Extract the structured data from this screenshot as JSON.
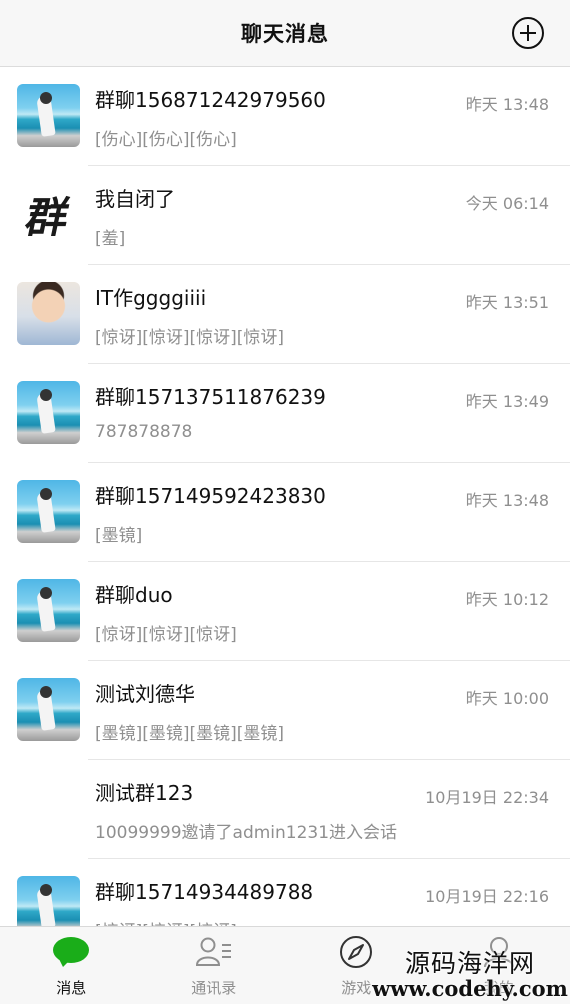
{
  "header": {
    "title": "聊天消息",
    "add_icon": "plus-circle-icon"
  },
  "conversations": [
    {
      "avatar": "beach-photo",
      "name": "群聊156871242979560",
      "time": "昨天 13:48",
      "preview": "[伤心][伤心][伤心]"
    },
    {
      "avatar": "calligraphy-qun",
      "avatar_text": "群",
      "name": "我自闭了",
      "time": "今天 06:14",
      "preview": "[羞]"
    },
    {
      "avatar": "baby-photo",
      "name": "IT作ggggiiii",
      "time": "昨天 13:51",
      "preview": "[惊讶][惊讶][惊讶][惊讶]"
    },
    {
      "avatar": "beach-photo",
      "name": "群聊157137511876239",
      "time": "昨天 13:49",
      "preview": "787878878"
    },
    {
      "avatar": "beach-photo",
      "name": "群聊157149592423830",
      "time": "昨天 13:48",
      "preview": "[墨镜]"
    },
    {
      "avatar": "beach-photo",
      "name": "群聊duo",
      "time": "昨天 10:12",
      "preview": "[惊讶][惊讶][惊讶]"
    },
    {
      "avatar": "beach-photo",
      "name": "测试刘德华",
      "time": "昨天 10:00",
      "preview": "[墨镜][墨镜][墨镜][墨镜]"
    },
    {
      "avatar": "none",
      "name": "测试群123",
      "time": "10月19日 22:34",
      "preview": "10099999邀请了admin1231进入会话"
    },
    {
      "avatar": "beach-photo",
      "name": "群聊15714934489788",
      "time": "10月19日 22:16",
      "preview": "[惊讶][惊讶][惊讶]"
    }
  ],
  "tabbar": {
    "items": [
      {
        "label": "消息",
        "icon": "chat-bubble-icon",
        "active": true
      },
      {
        "label": "通讯录",
        "icon": "contacts-icon",
        "active": false
      },
      {
        "label": "游戏",
        "icon": "compass-icon",
        "active": false
      },
      {
        "label": "我的",
        "icon": "user-icon",
        "active": false
      }
    ]
  },
  "watermark": {
    "line1": "源码海洋网",
    "line2": "www.codehy.com"
  },
  "colors": {
    "accent_green": "#1aad19",
    "muted_text": "#8f8f8f",
    "header_bg": "#f7f7f7"
  }
}
